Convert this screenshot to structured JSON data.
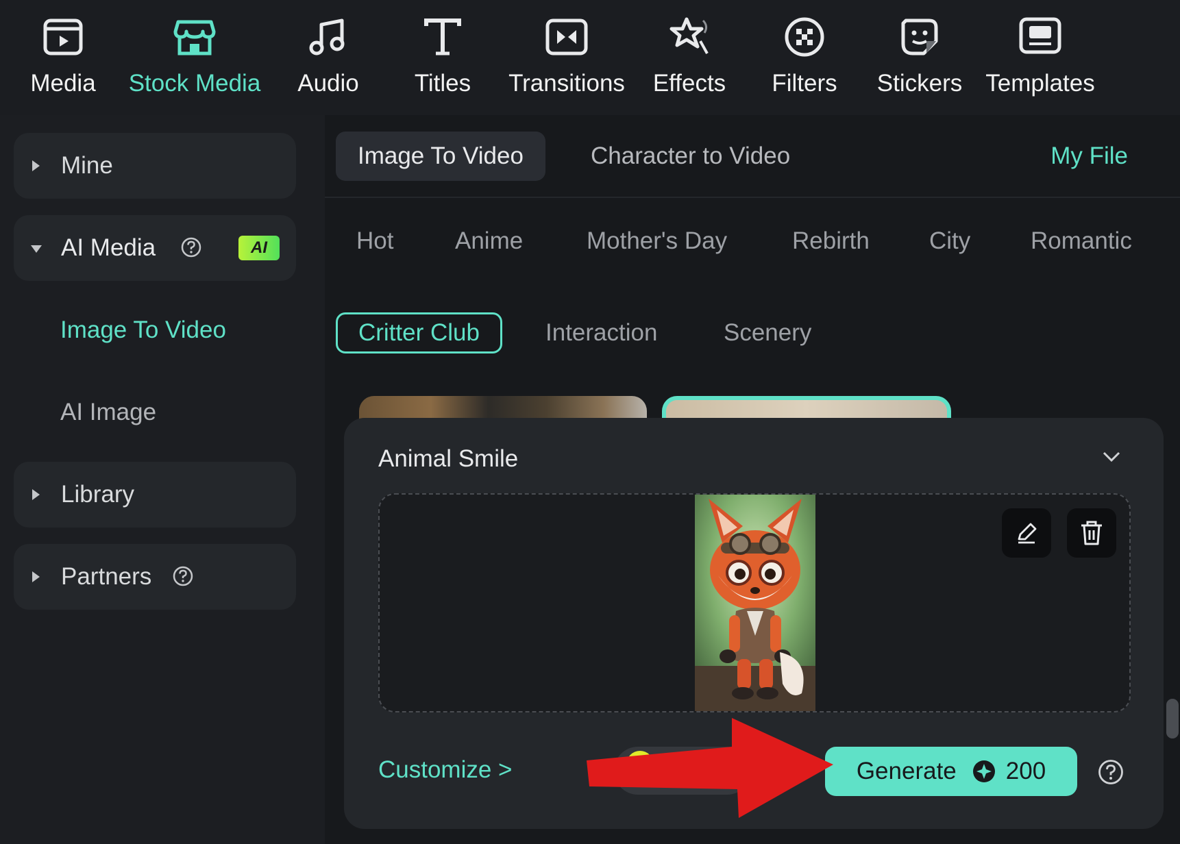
{
  "toolbar": {
    "tools": [
      {
        "label": "Media",
        "icon": "media-icon"
      },
      {
        "label": "Stock Media",
        "icon": "stock-media-icon",
        "active": true
      },
      {
        "label": "Audio",
        "icon": "music-note-icon"
      },
      {
        "label": "Titles",
        "icon": "titles-t-icon"
      },
      {
        "label": "Transitions",
        "icon": "transitions-icon"
      },
      {
        "label": "Effects",
        "icon": "effects-star-icon"
      },
      {
        "label": "Filters",
        "icon": "filters-icon"
      },
      {
        "label": "Stickers",
        "icon": "stickers-icon"
      },
      {
        "label": "Templates",
        "icon": "templates-icon"
      }
    ]
  },
  "sidebar": {
    "mine": "Mine",
    "ai_media": "AI Media",
    "ai_badge": "AI",
    "image_to_video": "Image To Video",
    "ai_image": "AI Image",
    "library": "Library",
    "partners": "Partners"
  },
  "main": {
    "tabs": [
      "Image To Video",
      "Character to Video"
    ],
    "my_file": "My File",
    "categories": [
      "Hot",
      "Anime",
      "Mother's Day",
      "Rebirth",
      "City",
      "Romantic"
    ],
    "subcategories": [
      "Critter Club",
      "Interaction",
      "Scenery"
    ]
  },
  "panel": {
    "title": "Animal Smile",
    "customize": "Customize >",
    "generate_label": "Generate",
    "credits": "200"
  },
  "colors": {
    "accent": "#5fe1c7",
    "background": "#17191c",
    "panel": "#24272b",
    "annotation_arrow": "#e01b1b"
  }
}
